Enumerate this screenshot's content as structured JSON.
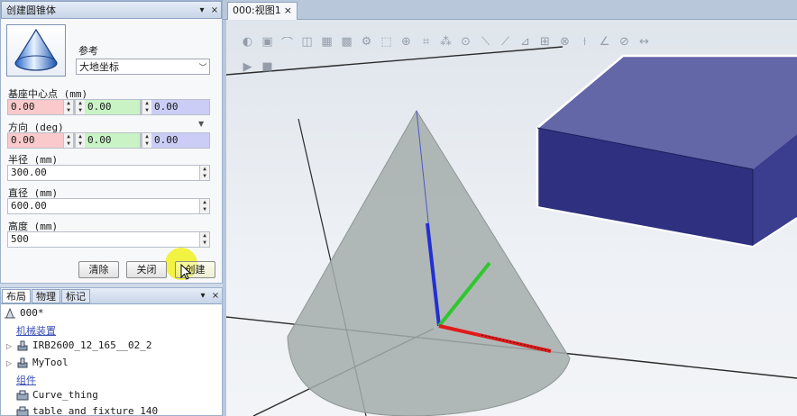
{
  "create_cone": {
    "title": "创建圆锥体",
    "reference_label": "参考",
    "reference_value": "大地坐标",
    "base_center_label": "基座中心点 (mm)",
    "base_center": [
      "0.00",
      "0.00",
      "0.00"
    ],
    "direction_label": "方向 (deg)",
    "direction": [
      "0.00",
      "0.00",
      "0.00"
    ],
    "radius_label": "半径 (mm)",
    "radius": "300.00",
    "diameter_label": "直径 (mm)",
    "diameter": "600.00",
    "height_label": "高度 (mm)",
    "height": "500",
    "clear_label": "清除",
    "close_label": "关闭",
    "create_label": "创建"
  },
  "layout": {
    "tabs": [
      "布局",
      "物理",
      "标记"
    ],
    "station": "000*",
    "mechanisms_label": "机械装置",
    "mechanisms": [
      "IRB2600_12_165__02_2",
      "MyTool"
    ],
    "components_label": "组件",
    "components": [
      "Curve_thing",
      "table_and_fixture_140"
    ]
  },
  "view": {
    "tab_label": "000:视图1",
    "toolbar_icons": [
      "shading-icon",
      "view-icon",
      "select-curve-icon",
      "select-surface-icon",
      "select-body-icon",
      "select-part-icon",
      "select-mechanism-icon",
      "select-group-icon",
      "select-target-icon",
      "select-frame-icon",
      "snap-object-icon",
      "snap-center-icon",
      "snap-midpoint-icon",
      "snap-edge-icon",
      "snap-corner-icon",
      "snap-grid-icon",
      "snap-origin-icon",
      "measure-point-icon",
      "measure-angle-icon",
      "measure-diameter-icon",
      "measure-distance-icon",
      "simulate-play-icon",
      "simulate-stop-icon"
    ],
    "colors": {
      "box_top": "#6366a7",
      "box_front": "#2f3180",
      "box_side": "#3b3d8e",
      "cone": "#a5adab",
      "axis_x": "#e11b1b",
      "axis_y": "#2ec82e",
      "axis_z": "#2230d2"
    }
  },
  "ui": {
    "close_glyph": "×",
    "pin_glyph": "▾",
    "spin_up": "▲",
    "spin_down": "▼",
    "dropdown_arrow": "﹀"
  }
}
